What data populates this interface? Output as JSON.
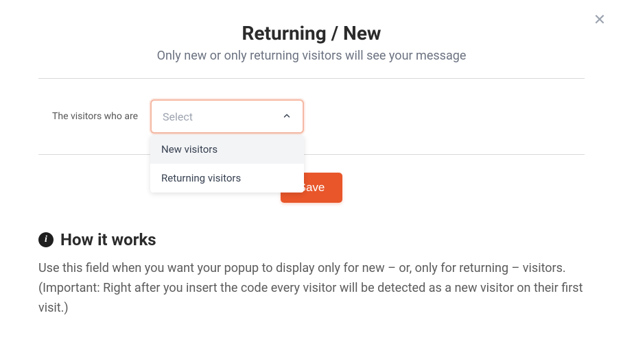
{
  "header": {
    "title": "Returning / New",
    "subtitle": "Only new or only returning visitors will see your message"
  },
  "form": {
    "label": "The visitors who are",
    "select": {
      "placeholder": "Select",
      "options": {
        "opt1": "New visitors",
        "opt2": "Returning visitors"
      }
    },
    "save_label": "Save"
  },
  "how": {
    "title": "How it works",
    "body": "Use this field when you want your popup to display only for new – or, only for returning – visitors. (Important: Right after you insert the code every visitor will be detected as a new visitor on their first visit.)"
  },
  "icons": {
    "close_glyph": "✕",
    "info_glyph": "i"
  }
}
